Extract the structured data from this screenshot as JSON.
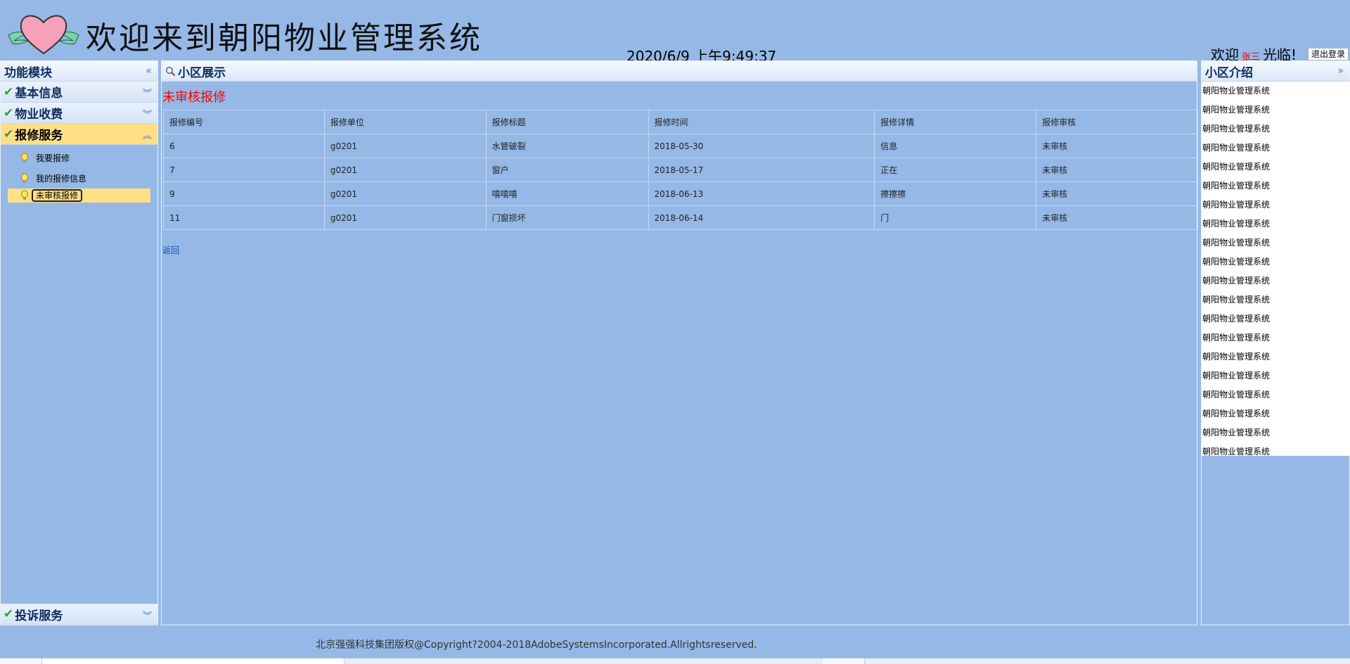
{
  "header": {
    "title": "欢迎来到朝阳物业管理系统",
    "clock": "2020/6/9 上午9:49:37",
    "welcome_prefix": "欢迎",
    "user": "张三",
    "welcome_suffix": "光临!",
    "logout": "退出登录"
  },
  "left": {
    "title": "功能模块",
    "groups": [
      {
        "label": "基本信息"
      },
      {
        "label": "物业收费"
      },
      {
        "label": "报修服务"
      }
    ],
    "subitems": [
      {
        "label": "我要报修"
      },
      {
        "label": "我的报修信息"
      },
      {
        "label": "未审核报修"
      }
    ],
    "bottom_group": {
      "label": "投诉服务"
    }
  },
  "center": {
    "title": "小区展示",
    "section_title": "未审核报修",
    "columns": [
      "报修编号",
      "报修单位",
      "报修标题",
      "报修时间",
      "报修详情",
      "报修审核"
    ],
    "rows": [
      [
        "6",
        "g0201",
        "水管破裂",
        "2018-05-30",
        "信息",
        "未审核"
      ],
      [
        "7",
        "g0201",
        "窗户",
        "2018-05-17",
        "正在",
        "未审核"
      ],
      [
        "9",
        "g0201",
        "嘻嘻嘻",
        "2018-06-13",
        "擦擦擦",
        "未审核"
      ],
      [
        "11",
        "g0201",
        "门窗损坏",
        "2018-06-14",
        "门",
        "未审核"
      ]
    ],
    "back_link": "返回"
  },
  "right": {
    "title": "小区介绍",
    "items": [
      "朝阳物业管理系统",
      "朝阳物业管理系统",
      "朝阳物业管理系统",
      "朝阳物业管理系统",
      "朝阳物业管理系统",
      "朝阳物业管理系统",
      "朝阳物业管理系统",
      "朝阳物业管理系统",
      "朝阳物业管理系统",
      "朝阳物业管理系统",
      "朝阳物业管理系统",
      "朝阳物业管理系统",
      "朝阳物业管理系统",
      "朝阳物业管理系统",
      "朝阳物业管理系统",
      "朝阳物业管理系统",
      "朝阳物业管理系统",
      "朝阳物业管理系统",
      "朝阳物业管理系统",
      "朝阳物业管理系统"
    ]
  },
  "footer": {
    "copyright": "北京强强科技集团版权@Copyright?2004-2018AdobeSystemsIncorporated.Allrightsreserved."
  },
  "colors": {
    "background": "#95b8e6",
    "accent": "#ffe087",
    "alert": "#ff0000"
  }
}
